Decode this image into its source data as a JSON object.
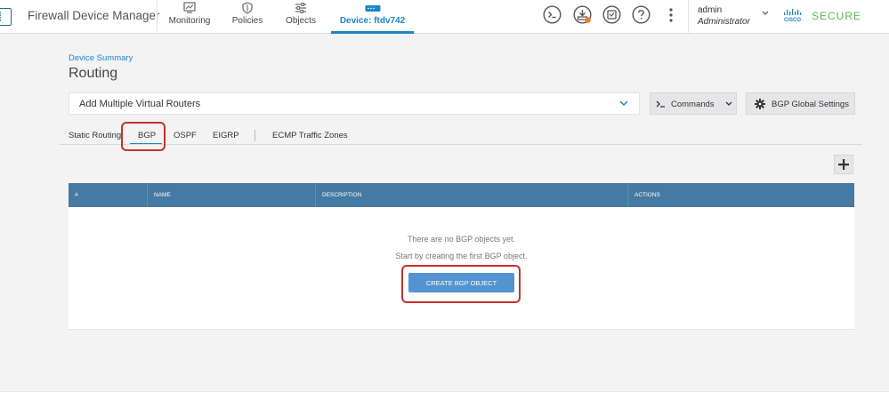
{
  "app": {
    "title": "Firewall Device Manager"
  },
  "nav": {
    "monitoring": "Monitoring",
    "policies": "Policies",
    "objects": "Objects",
    "device_prefix": "Device:",
    "device_name": "ftdv742"
  },
  "toolbar_icons": [
    "cli-console-icon",
    "deployment-icon",
    "api-explorer-icon",
    "help-icon",
    "more-options-icon"
  ],
  "user": {
    "name": "admin",
    "role": "Administrator"
  },
  "brand": {
    "secure": "SECURE"
  },
  "page": {
    "breadcrumb": "Device Summary",
    "title": "Routing"
  },
  "router_select": {
    "value": "Add Multiple Virtual Routers"
  },
  "buttons": {
    "commands": "Commands",
    "bgp_global": "BGP Global Settings"
  },
  "tabs": [
    {
      "label": "Static Routing"
    },
    {
      "label": "BGP",
      "active": true
    },
    {
      "label": "OSPF"
    },
    {
      "label": "EIGRP"
    },
    {
      "label": "ECMP Traffic Zones"
    }
  ],
  "table": {
    "columns": [
      "#",
      "NAME",
      "DESCRIPTION",
      "ACTIONS"
    ],
    "empty_line1": "There are no BGP objects yet.",
    "empty_line2": "Start by creating the first BGP object.",
    "create_button": "CREATE BGP OBJECT"
  },
  "colors": {
    "accent": "#1b86c6",
    "table_header": "#447aa3",
    "primary_button": "#5294cf",
    "highlight": "#c8302e",
    "brand_green": "#5bbb4f"
  }
}
